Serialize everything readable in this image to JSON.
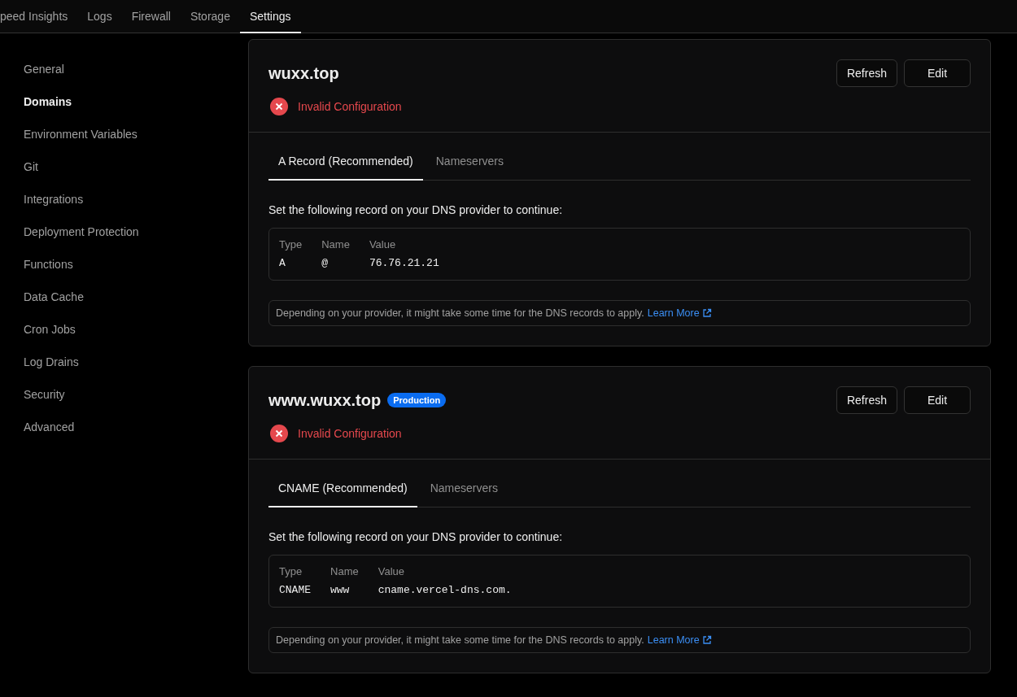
{
  "top_tabs": [
    {
      "label": "peed Insights",
      "selected": false
    },
    {
      "label": "Logs",
      "selected": false
    },
    {
      "label": "Firewall",
      "selected": false
    },
    {
      "label": "Storage",
      "selected": false
    },
    {
      "label": "Settings",
      "selected": true
    }
  ],
  "sidebar": {
    "items": [
      {
        "label": "General",
        "selected": false
      },
      {
        "label": "Domains",
        "selected": true
      },
      {
        "label": "Environment Variables",
        "selected": false
      },
      {
        "label": "Git",
        "selected": false
      },
      {
        "label": "Integrations",
        "selected": false
      },
      {
        "label": "Deployment Protection",
        "selected": false
      },
      {
        "label": "Functions",
        "selected": false
      },
      {
        "label": "Data Cache",
        "selected": false
      },
      {
        "label": "Cron Jobs",
        "selected": false
      },
      {
        "label": "Log Drains",
        "selected": false
      },
      {
        "label": "Security",
        "selected": false
      },
      {
        "label": "Advanced",
        "selected": false
      }
    ]
  },
  "domains": [
    {
      "name": "wuxx.top",
      "buttons": [
        "Refresh",
        "Edit"
      ],
      "status": {
        "kind": "error",
        "text": "Invalid Configuration"
      },
      "tabs": [
        {
          "label": "A Record (Recommended)",
          "selected": true
        },
        {
          "label": "Nameservers",
          "selected": false
        }
      ],
      "instruction": "Set the following record on your DNS provider to continue:",
      "record": {
        "columns": [
          "Type",
          "Name",
          "Value"
        ],
        "values": [
          "A",
          "@",
          "76.76.21.21"
        ]
      },
      "note": "Depending on your provider, it might take some time for the DNS records to apply.",
      "link": "Learn More"
    },
    {
      "name": "www.wuxx.top",
      "badge": "Production",
      "buttons": [
        "Refresh",
        "Edit"
      ],
      "status": {
        "kind": "error",
        "text": "Invalid Configuration"
      },
      "tabs": [
        {
          "label": "CNAME (Recommended)",
          "selected": true
        },
        {
          "label": "Nameservers",
          "selected": false
        }
      ],
      "instruction": "Set the following record on your DNS provider to continue:",
      "record": {
        "columns": [
          "Type",
          "Name",
          "Value"
        ],
        "values": [
          "CNAME",
          "www",
          "cname.vercel-dns.com."
        ]
      },
      "note": "Depending on your provider, it might take some time for the DNS records to apply.",
      "link": "Learn More"
    }
  ]
}
